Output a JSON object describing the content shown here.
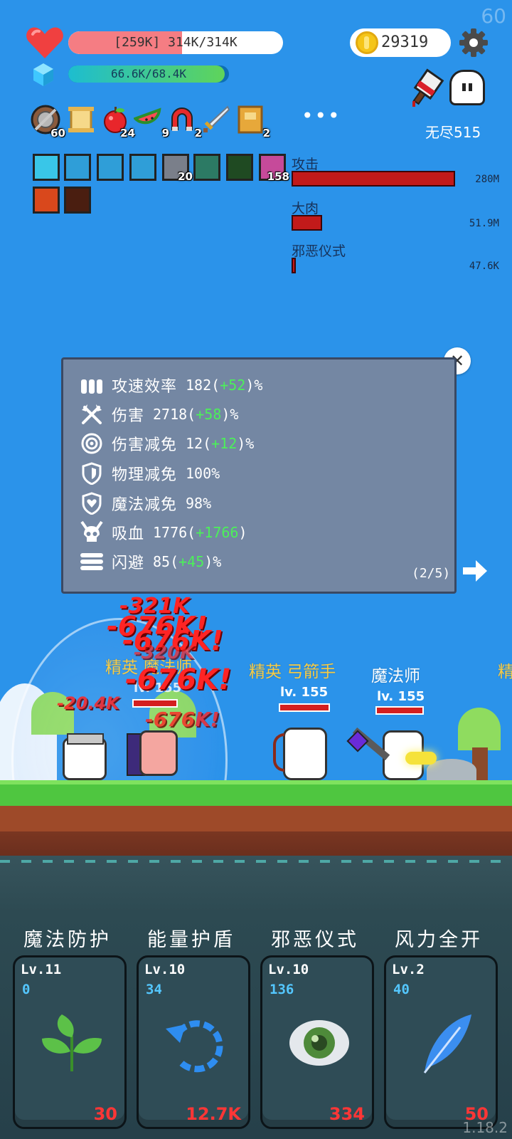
{
  "fps": "60",
  "version": "1.18.2",
  "hp": {
    "text": "[259K] 314K/314K",
    "fraction": 0.53
  },
  "mp": {
    "text": "66.6K/68.4K",
    "fraction": 0.974
  },
  "coins": "29319",
  "mode": "无尽515",
  "items": [
    {
      "icon": "shield-icon",
      "count": "60"
    },
    {
      "icon": "scroll-icon",
      "count": ""
    },
    {
      "icon": "apple-icon",
      "count": "24"
    },
    {
      "icon": "watermelon-icon",
      "count": "9"
    },
    {
      "icon": "magnet-icon",
      "count": "2"
    },
    {
      "icon": "sword-icon",
      "count": ""
    },
    {
      "icon": "book-icon",
      "count": "2"
    }
  ],
  "more": "•••",
  "buffs": [
    {
      "icon": "light-buff-icon",
      "count": ""
    },
    {
      "icon": "vortex-buff-icon",
      "count": ""
    },
    {
      "icon": "vortex-buff-icon",
      "count": ""
    },
    {
      "icon": "vortex-buff-icon",
      "count": ""
    },
    {
      "icon": "chest-buff-icon",
      "count": "20"
    },
    {
      "icon": "spirit-buff-icon",
      "count": ""
    },
    {
      "icon": "poison-buff-icon",
      "count": ""
    },
    {
      "icon": "bunny-buff-icon",
      "count": "158"
    },
    {
      "icon": "fire-buff-icon",
      "count": ""
    },
    {
      "icon": "burn-buff-icon",
      "count": ""
    }
  ],
  "damage_stats": [
    {
      "label": "攻击",
      "value": "280M",
      "fraction": 1.0
    },
    {
      "label": "大肉",
      "value": "51.9M",
      "fraction": 0.185
    },
    {
      "label": "邪恶仪式",
      "value": "47.6K",
      "fraction": 0.02
    }
  ],
  "stats": [
    {
      "icon": "bullets-icon",
      "name": "攻速效率",
      "base": "182(",
      "bonus": "+52",
      "tail": ")%"
    },
    {
      "icon": "crossed-axes-icon",
      "name": "伤害",
      "base": "2718(",
      "bonus": "+58",
      "tail": ")%"
    },
    {
      "icon": "target-icon",
      "name": "伤害减免",
      "base": "12(",
      "bonus": "+12",
      "tail": ")%"
    },
    {
      "icon": "shield-outline-icon",
      "name": "物理减免",
      "base": "100%",
      "bonus": "",
      "tail": ""
    },
    {
      "icon": "heart-shield-icon",
      "name": "魔法减免",
      "base": "98%",
      "bonus": "",
      "tail": ""
    },
    {
      "icon": "skull-icon",
      "name": "吸血",
      "base": "1776(",
      "bonus": "+1766",
      "tail": ")"
    },
    {
      "icon": "dash-lines-icon",
      "name": "闪避",
      "base": "85(",
      "bonus": "+45",
      "tail": ")%"
    }
  ],
  "page_indicator": "(2/5)",
  "enemies": [
    {
      "name": "精英 弓箭手",
      "elite": true,
      "level": "lv. 155"
    },
    {
      "name": "魔法师",
      "elite": false,
      "level": "lv. 155"
    },
    {
      "name": "精英 魔法师",
      "elite": true,
      "level": "lv. 155"
    },
    {
      "name": "精",
      "elite": true,
      "level": ""
    }
  ],
  "floating_damage": [
    "-321K",
    "-676K!",
    "-676K!",
    "-320K",
    "-676K!",
    "-676K!",
    "-20.4K"
  ],
  "skills": [
    {
      "name": "魔法防护",
      "level": "Lv.11",
      "energy": "0",
      "cost": "30",
      "icon": "leaf-icon"
    },
    {
      "name": "能量护盾",
      "level": "Lv.10",
      "energy": "34",
      "cost": "12.7K",
      "icon": "refresh-arrow-icon"
    },
    {
      "name": "邪恶仪式",
      "level": "Lv.10",
      "energy": "136",
      "cost": "334",
      "icon": "eye-icon"
    },
    {
      "name": "风力全开",
      "level": "Lv.2",
      "energy": "40",
      "cost": "50",
      "icon": "feather-icon"
    }
  ],
  "colors": {
    "sky": "#2b93ea",
    "hp": "#f57d83",
    "panel": "#7487a3",
    "bonus": "#4cf05a",
    "damage": "#ff2424"
  }
}
